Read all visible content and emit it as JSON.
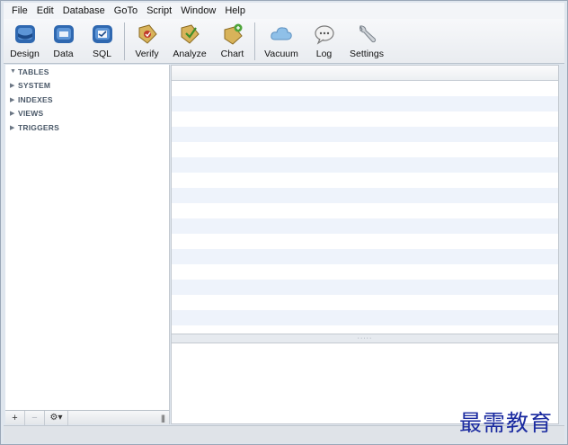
{
  "menu": [
    "File",
    "Edit",
    "Database",
    "GoTo",
    "Script",
    "Window",
    "Help"
  ],
  "toolbar": {
    "group1": [
      {
        "label": "Design",
        "icon": "design-icon"
      },
      {
        "label": "Data",
        "icon": "data-icon"
      },
      {
        "label": "SQL",
        "icon": "sql-icon"
      }
    ],
    "group2": [
      {
        "label": "Verify",
        "icon": "verify-icon"
      },
      {
        "label": "Analyze",
        "icon": "analyze-icon"
      },
      {
        "label": "Chart",
        "icon": "chart-icon"
      }
    ],
    "group3": [
      {
        "label": "Vacuum",
        "icon": "vacuum-cloud-icon"
      },
      {
        "label": "Log",
        "icon": "log-speech-icon"
      },
      {
        "label": "Settings",
        "icon": "settings-wrench-icon"
      }
    ]
  },
  "sidebar": {
    "items": [
      {
        "label": "TABLES",
        "expanded": true
      },
      {
        "label": "SYSTEM",
        "expanded": false
      },
      {
        "label": "INDEXES",
        "expanded": false
      },
      {
        "label": "VIEWS",
        "expanded": false
      },
      {
        "label": "TRIGGERS",
        "expanded": false
      }
    ],
    "footer": {
      "add": "+",
      "remove": "−",
      "gear": "⚙▾",
      "grip": "|||"
    }
  },
  "splitter": {
    "grip": "·····"
  },
  "watermark": "最需教育",
  "colors": {
    "stripe": "#eef3fb",
    "db_blue": "#2f68b0",
    "tree_text": "#4a5868",
    "watermark": "#1a2aa0"
  }
}
